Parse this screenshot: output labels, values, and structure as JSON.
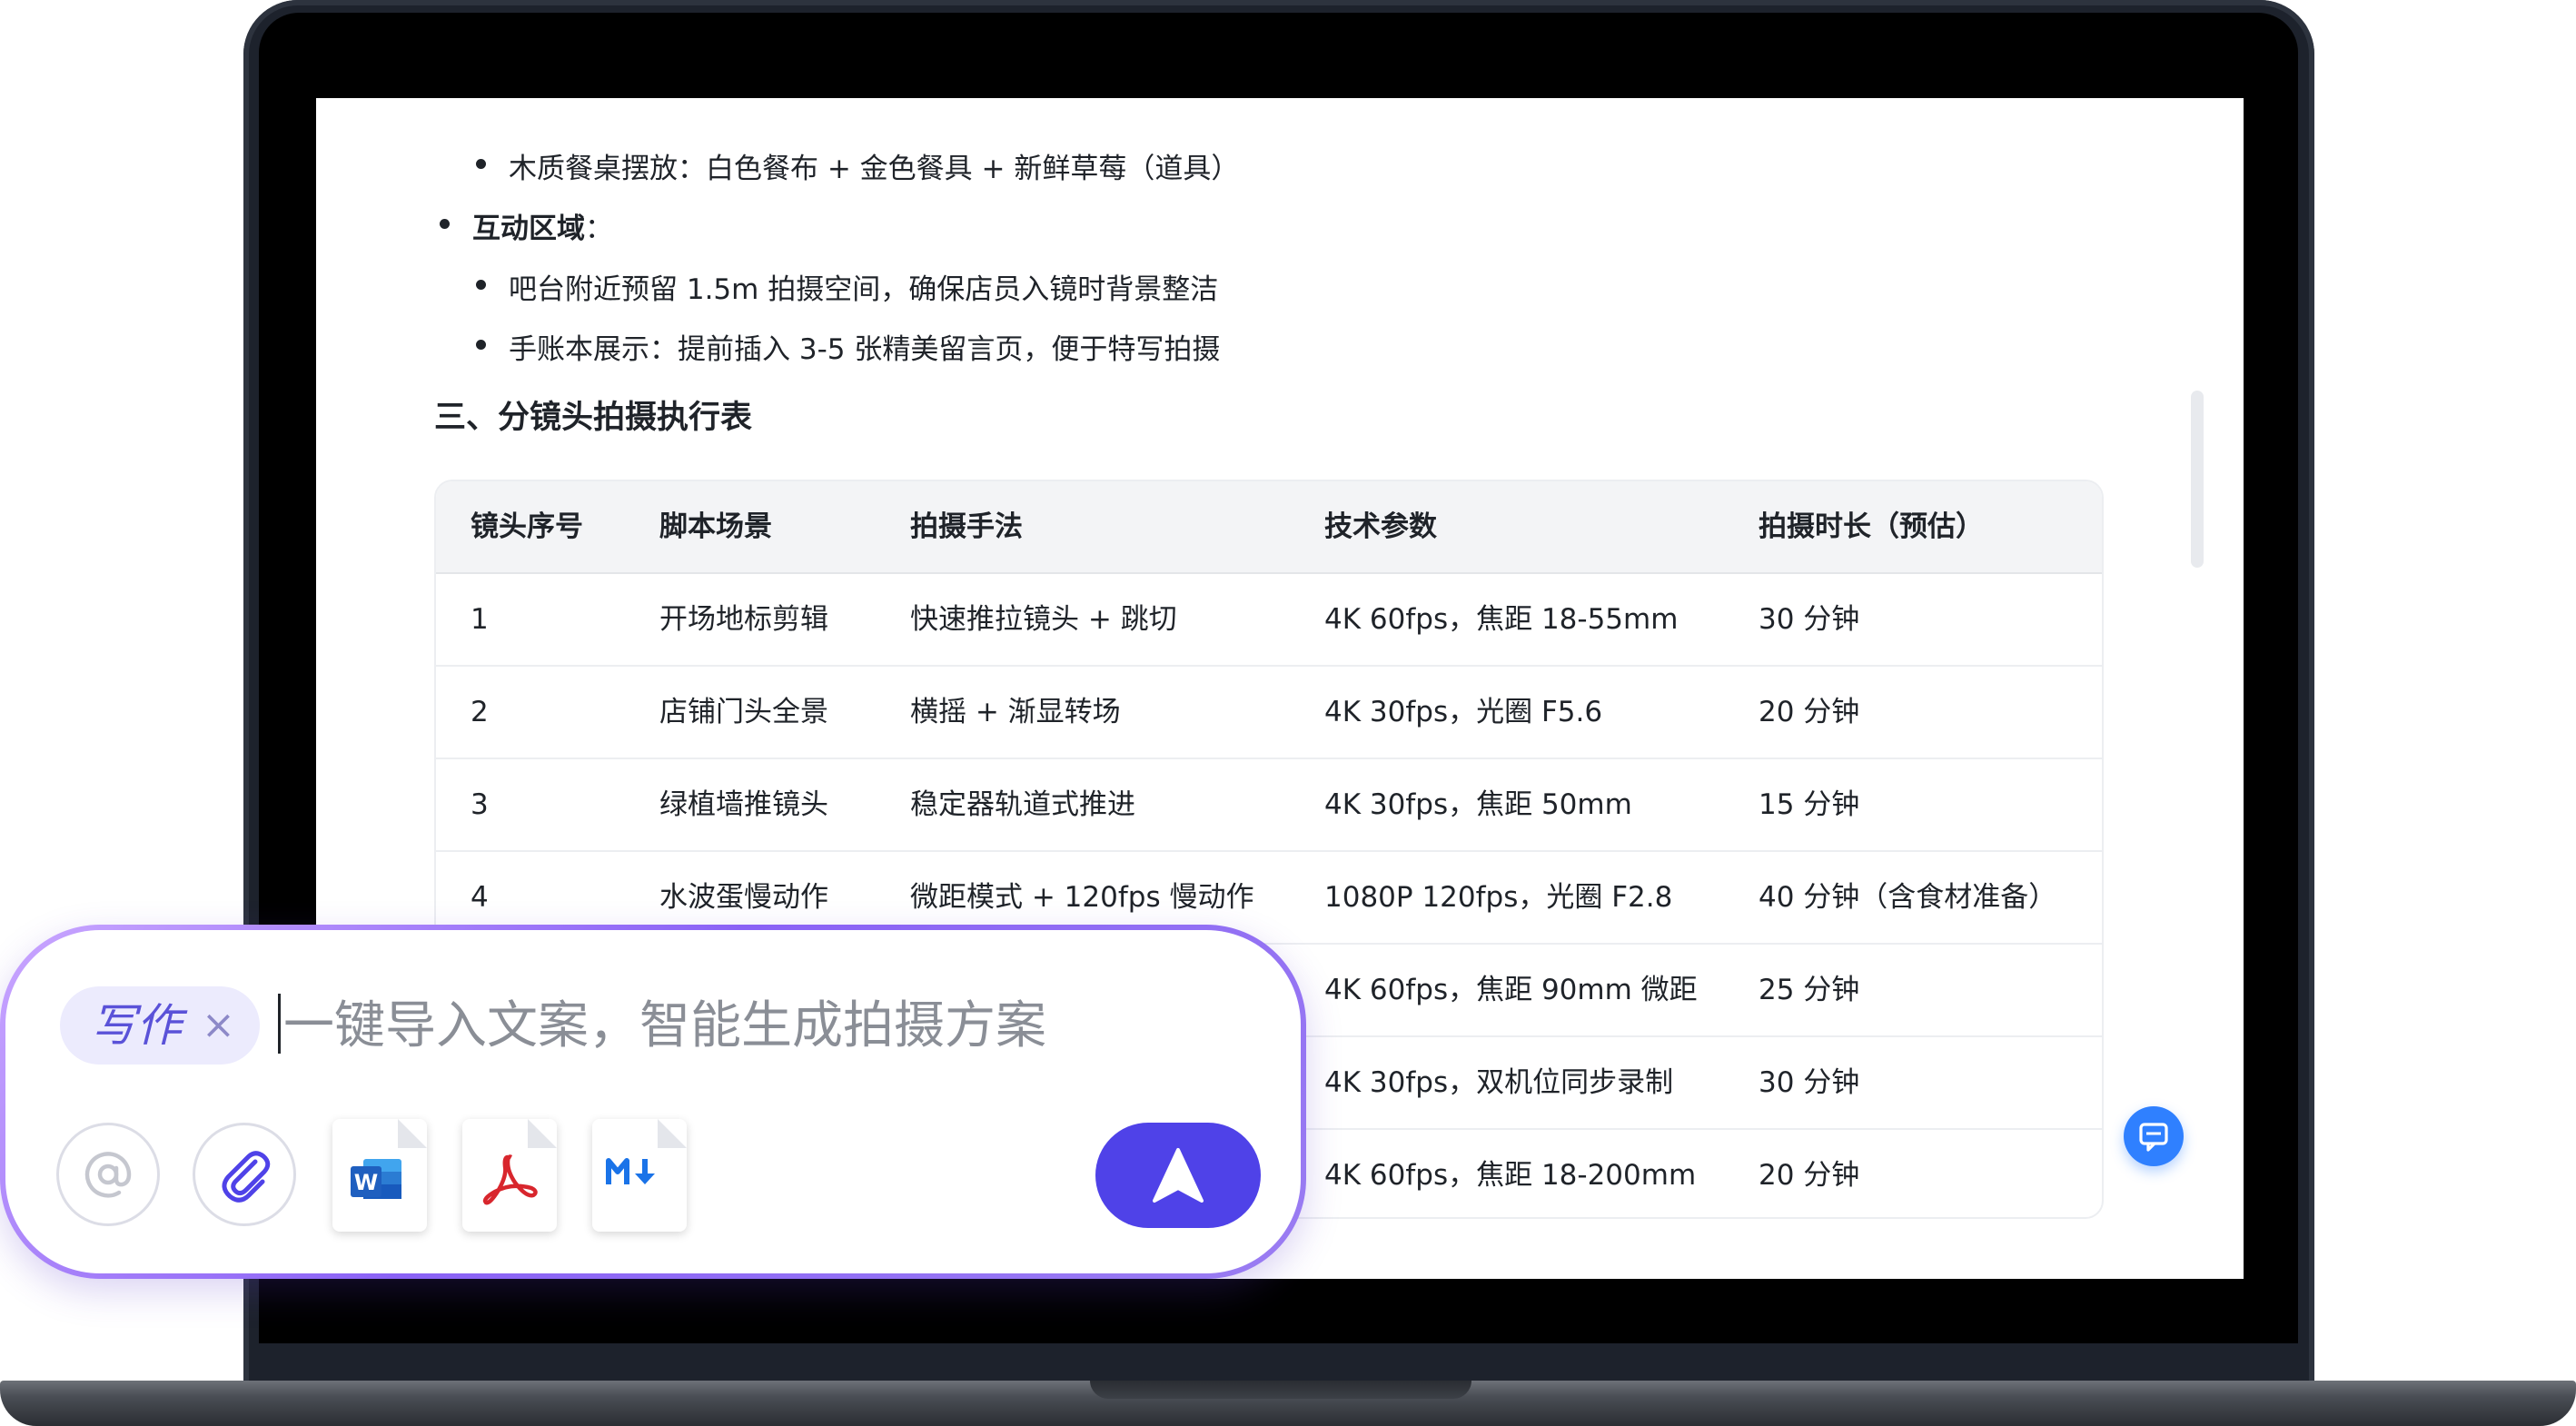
{
  "document": {
    "bullet_props": "木质餐桌摆放：白色餐布 + 金色餐具 + 新鲜草莓（道具）",
    "interactive_area_title": "互动区域",
    "interactive_area_colon": "：",
    "bullet_bar": "吧台附近预留 1.5m 拍摄空间，确保店员入镜时背景整洁",
    "bullet_notebook": "手账本展示：提前插入 3-5 张精美留言页，便于特写拍摄",
    "section_title": "三、分镜头拍摄执行表"
  },
  "table": {
    "headers": [
      "镜头序号",
      "脚本场景",
      "拍摄手法",
      "技术参数",
      "拍摄时长（预估）"
    ],
    "rows": [
      [
        "1",
        "开场地标剪辑",
        "快速推拉镜头 + 跳切",
        "4K 60fps，焦距 18-55mm",
        "30 分钟"
      ],
      [
        "2",
        "店铺门头全景",
        "横摇 + 渐显转场",
        "4K 30fps，光圈 F5.6",
        "20 分钟"
      ],
      [
        "3",
        "绿植墙推镜头",
        "稳定器轨道式推进",
        "4K 30fps，焦距 50mm",
        "15 分钟"
      ],
      [
        "4",
        "水波蛋慢动作",
        "微距模式 + 120fps 慢动作",
        "1080P 120fps，光圈 F2.8",
        "40 分钟（含食材准备）"
      ],
      [
        "",
        "",
        "",
        "4K 60fps，焦距 90mm 微距",
        "25 分钟"
      ],
      [
        "",
        "",
        "",
        "4K 30fps，双机位同步录制",
        "30 分钟"
      ],
      [
        "",
        "",
        "",
        "4K 60fps，焦距 18-200mm",
        "20 分钟"
      ]
    ]
  },
  "prompt": {
    "tag_label": "写作",
    "tag_close": "×",
    "placeholder": "一键导入文案，智能生成拍摄方案",
    "value": ""
  },
  "icons": {
    "mention": "at-icon",
    "attach": "paperclip-icon",
    "word": "word-file-icon",
    "pdf": "pdf-file-icon",
    "markdown": "markdown-file-icon",
    "send": "send-arrow-icon",
    "chat": "chat-bubble-icon"
  },
  "colors": {
    "accent": "#4f42e8",
    "chip_bg": "#ecebfd",
    "chat_button": "#2f80ff",
    "word_blue": "#1f5fbf",
    "pdf_red": "#d8262d",
    "markdown_blue": "#1a73e8"
  }
}
